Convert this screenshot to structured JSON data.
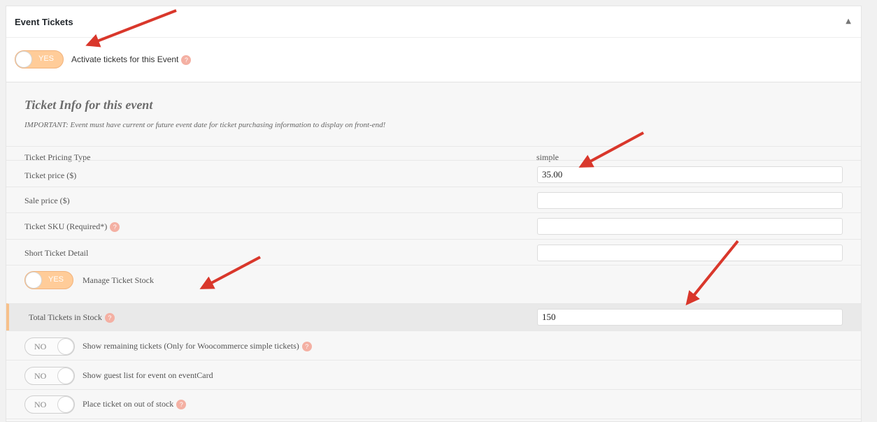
{
  "metabox": {
    "title": "Event Tickets",
    "collapse_icon": "triangle-up-icon",
    "collapse_glyph": "▲"
  },
  "activate": {
    "toggle_label": "YES",
    "label": "Activate tickets for this Event",
    "help_glyph": "?"
  },
  "ticket_info": {
    "title": "Ticket Info for this event",
    "note": "IMPORTANT: Event must have current or future event date for ticket purchasing information to display on front-end!",
    "pricing_type": {
      "label": "Ticket Pricing Type",
      "value": "simple"
    },
    "price": {
      "label": "Ticket price ($)",
      "value": "35.00"
    },
    "sale_price": {
      "label": "Sale price ($)",
      "value": ""
    },
    "sku": {
      "label": "Ticket SKU (Required*)",
      "value": ""
    },
    "short_detail": {
      "label": "Short Ticket Detail",
      "value": ""
    },
    "manage_stock": {
      "toggle_label": "YES",
      "label": "Manage Ticket Stock"
    },
    "total_stock": {
      "label": "Total Tickets in Stock",
      "value": "150"
    },
    "show_remaining": {
      "toggle_label": "NO",
      "label": "Show remaining tickets (Only for Woocommerce simple tickets)"
    },
    "guest_list": {
      "toggle_label": "NO",
      "label": "Show guest list for event on eventCard"
    },
    "out_of_stock": {
      "toggle_label": "NO",
      "label": "Place ticket on out of stock"
    }
  },
  "colors": {
    "toggle_on": "#ffcc99",
    "help_badge": "#f4b0a3",
    "annotation_arrow": "#d9372b",
    "highlight_bar": "#f7c08a"
  }
}
